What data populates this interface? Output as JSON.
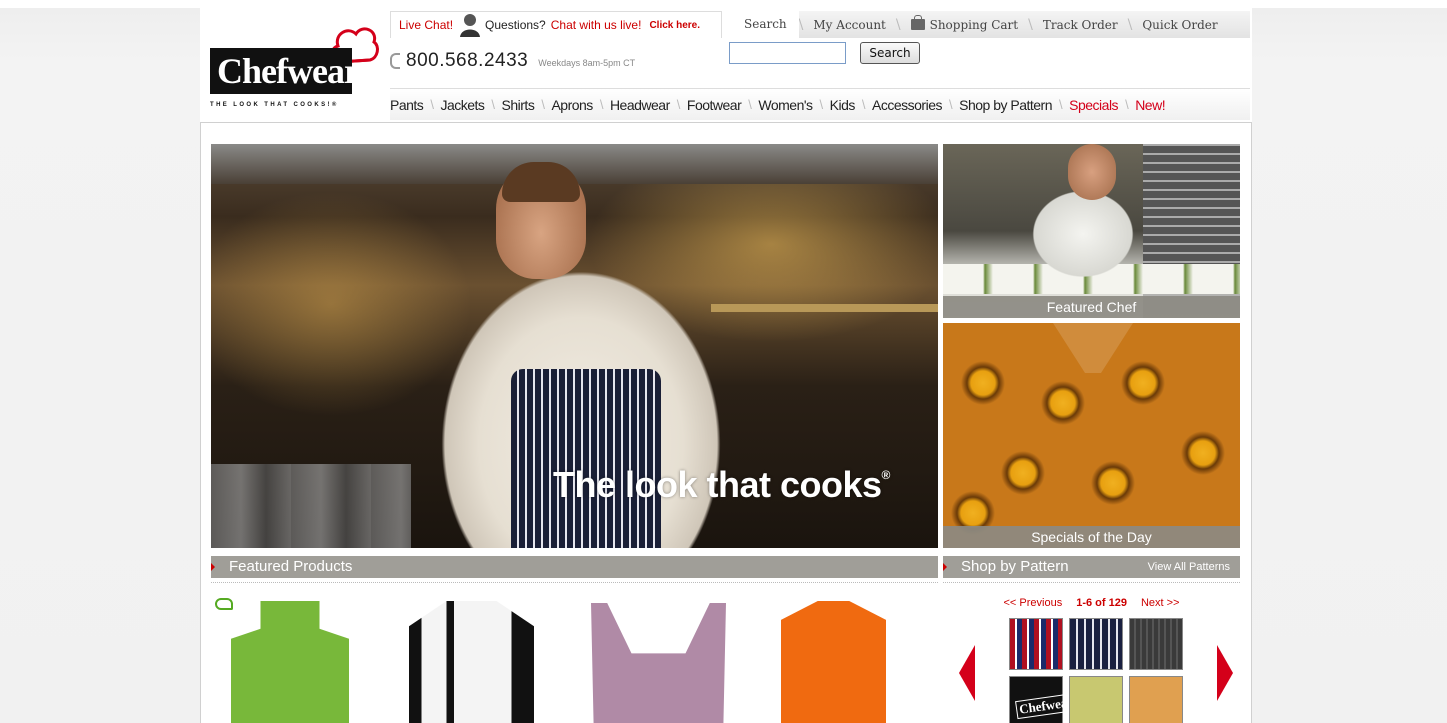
{
  "brand": {
    "name": "Chefwear",
    "tagline": "THE LOOK THAT COOKS!®"
  },
  "livechat": {
    "label": "Live Chat!",
    "question": "Questions?",
    "chat_link": "Chat with us live!",
    "click": "Click here."
  },
  "util_tabs": {
    "search": "Search",
    "account": "My Account",
    "cart": "Shopping Cart",
    "track": "Track Order",
    "quick": "Quick Order"
  },
  "phone": {
    "number": "800.568.2433",
    "hours": "Weekdays 8am-5pm CT"
  },
  "search": {
    "value": "",
    "button": "Search"
  },
  "nav": {
    "items": [
      "Pants",
      "Jackets",
      "Shirts",
      "Aprons",
      "Headwear",
      "Footwear",
      "Women's",
      "Kids",
      "Accessories",
      "Shop by Pattern"
    ],
    "specials": "Specials",
    "new": "New!"
  },
  "hero": {
    "tagline": "The look that cooks",
    "reg": "®"
  },
  "side": {
    "featured_chef": "Featured Chef",
    "specials": "Specials of the Day"
  },
  "sections": {
    "featured_products": "Featured Products",
    "shop_by_pattern": "Shop by Pattern",
    "view_all": "View All Patterns"
  },
  "pager": {
    "previous": "<< Previous",
    "count": "1-6 of 129",
    "next": "Next >>"
  },
  "colors": {
    "accent_red": "#d4001a",
    "bar_gray": "#a09e98"
  }
}
